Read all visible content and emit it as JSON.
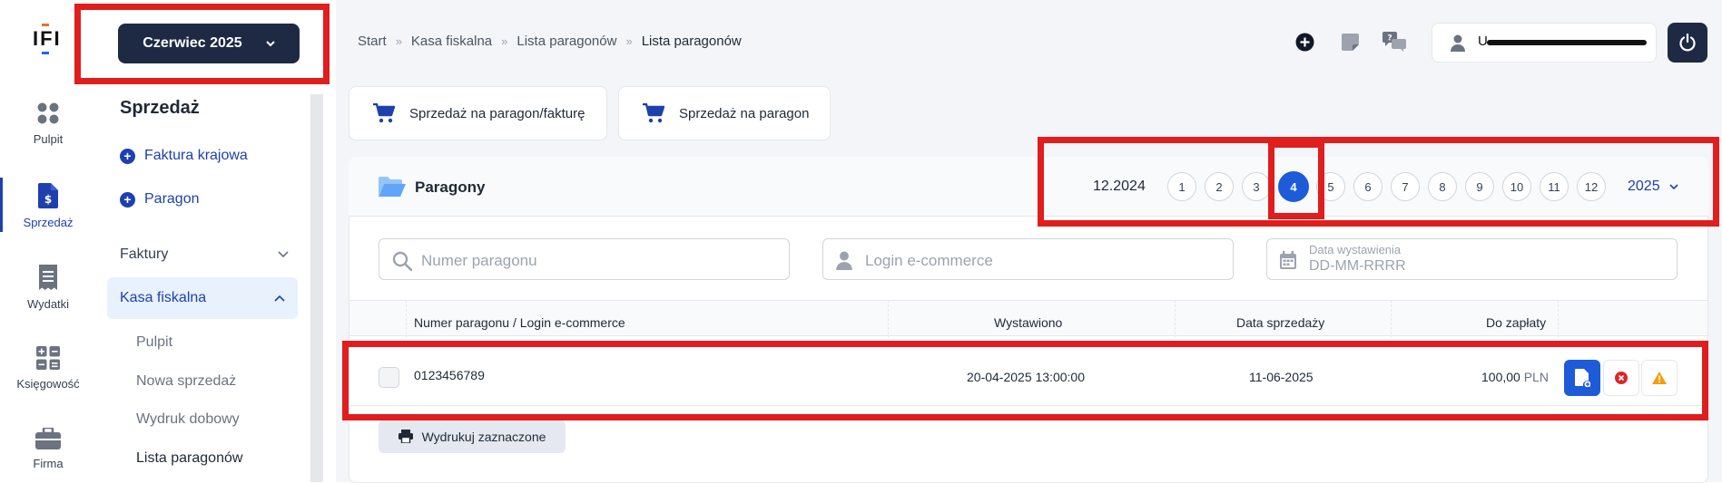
{
  "rail": {
    "logo": "IFI",
    "items": [
      {
        "label": "Pulpit",
        "icon": "dashboard-icon"
      },
      {
        "label": "Sprzedaż",
        "icon": "invoice-dollar-icon",
        "active": true
      },
      {
        "label": "Wydatki",
        "icon": "receipt-icon"
      },
      {
        "label": "Księgowość",
        "icon": "calculator-icon"
      },
      {
        "label": "Firma",
        "icon": "briefcase-icon"
      }
    ]
  },
  "sidebar": {
    "month_button": "Czerwiec 2025",
    "heading": "Sprzedaż",
    "quick_links": [
      "Faktura krajowa",
      "Paragon"
    ],
    "sections": [
      {
        "label": "Faktury",
        "expanded": false
      },
      {
        "label": "Kasa fiskalna",
        "expanded": true
      }
    ],
    "sub_items": [
      "Pulpit",
      "Nowa sprzedaż",
      "Wydruk dobowy",
      "Lista paragonów"
    ]
  },
  "breadcrumb": [
    "Start",
    "Kasa fiskalna",
    "Lista paragonów",
    "Lista paragonów"
  ],
  "breadcrumb_sep": "»",
  "header": {
    "user_initial": "U"
  },
  "actions": {
    "sale_receipt_invoice": "Sprzedaż na paragon/fakturę",
    "sale_receipt": "Sprzedaż na paragon"
  },
  "panel": {
    "title": "Paragony",
    "period_label": "12.2024",
    "months": [
      "1",
      "2",
      "3",
      "4",
      "5",
      "6",
      "7",
      "8",
      "9",
      "10",
      "11",
      "12"
    ],
    "active_month": "4",
    "year": "2025"
  },
  "filters": {
    "receipt_number_placeholder": "Numer paragonu",
    "login_placeholder": "Login e-commerce",
    "date_label": "Data wystawienia",
    "date_placeholder": "DD-MM-RRRR"
  },
  "table": {
    "headers": [
      "Numer paragonu / Login e-commerce",
      "Wystawiono",
      "Data sprzedaży",
      "Do zapłaty"
    ],
    "rows": [
      {
        "number": "0123456789",
        "issued": "20-04-2025 13:00:00",
        "sale_date": "11-06-2025",
        "amount": "100,00",
        "currency": "PLN"
      }
    ]
  },
  "print_selected": "Wydrukuj zaznaczone",
  "colors": {
    "navy": "#1e2a44",
    "primary": "#1e5bd8",
    "highlight": "#e11d1d",
    "warning": "#f59e0b",
    "danger": "#dc2626"
  }
}
